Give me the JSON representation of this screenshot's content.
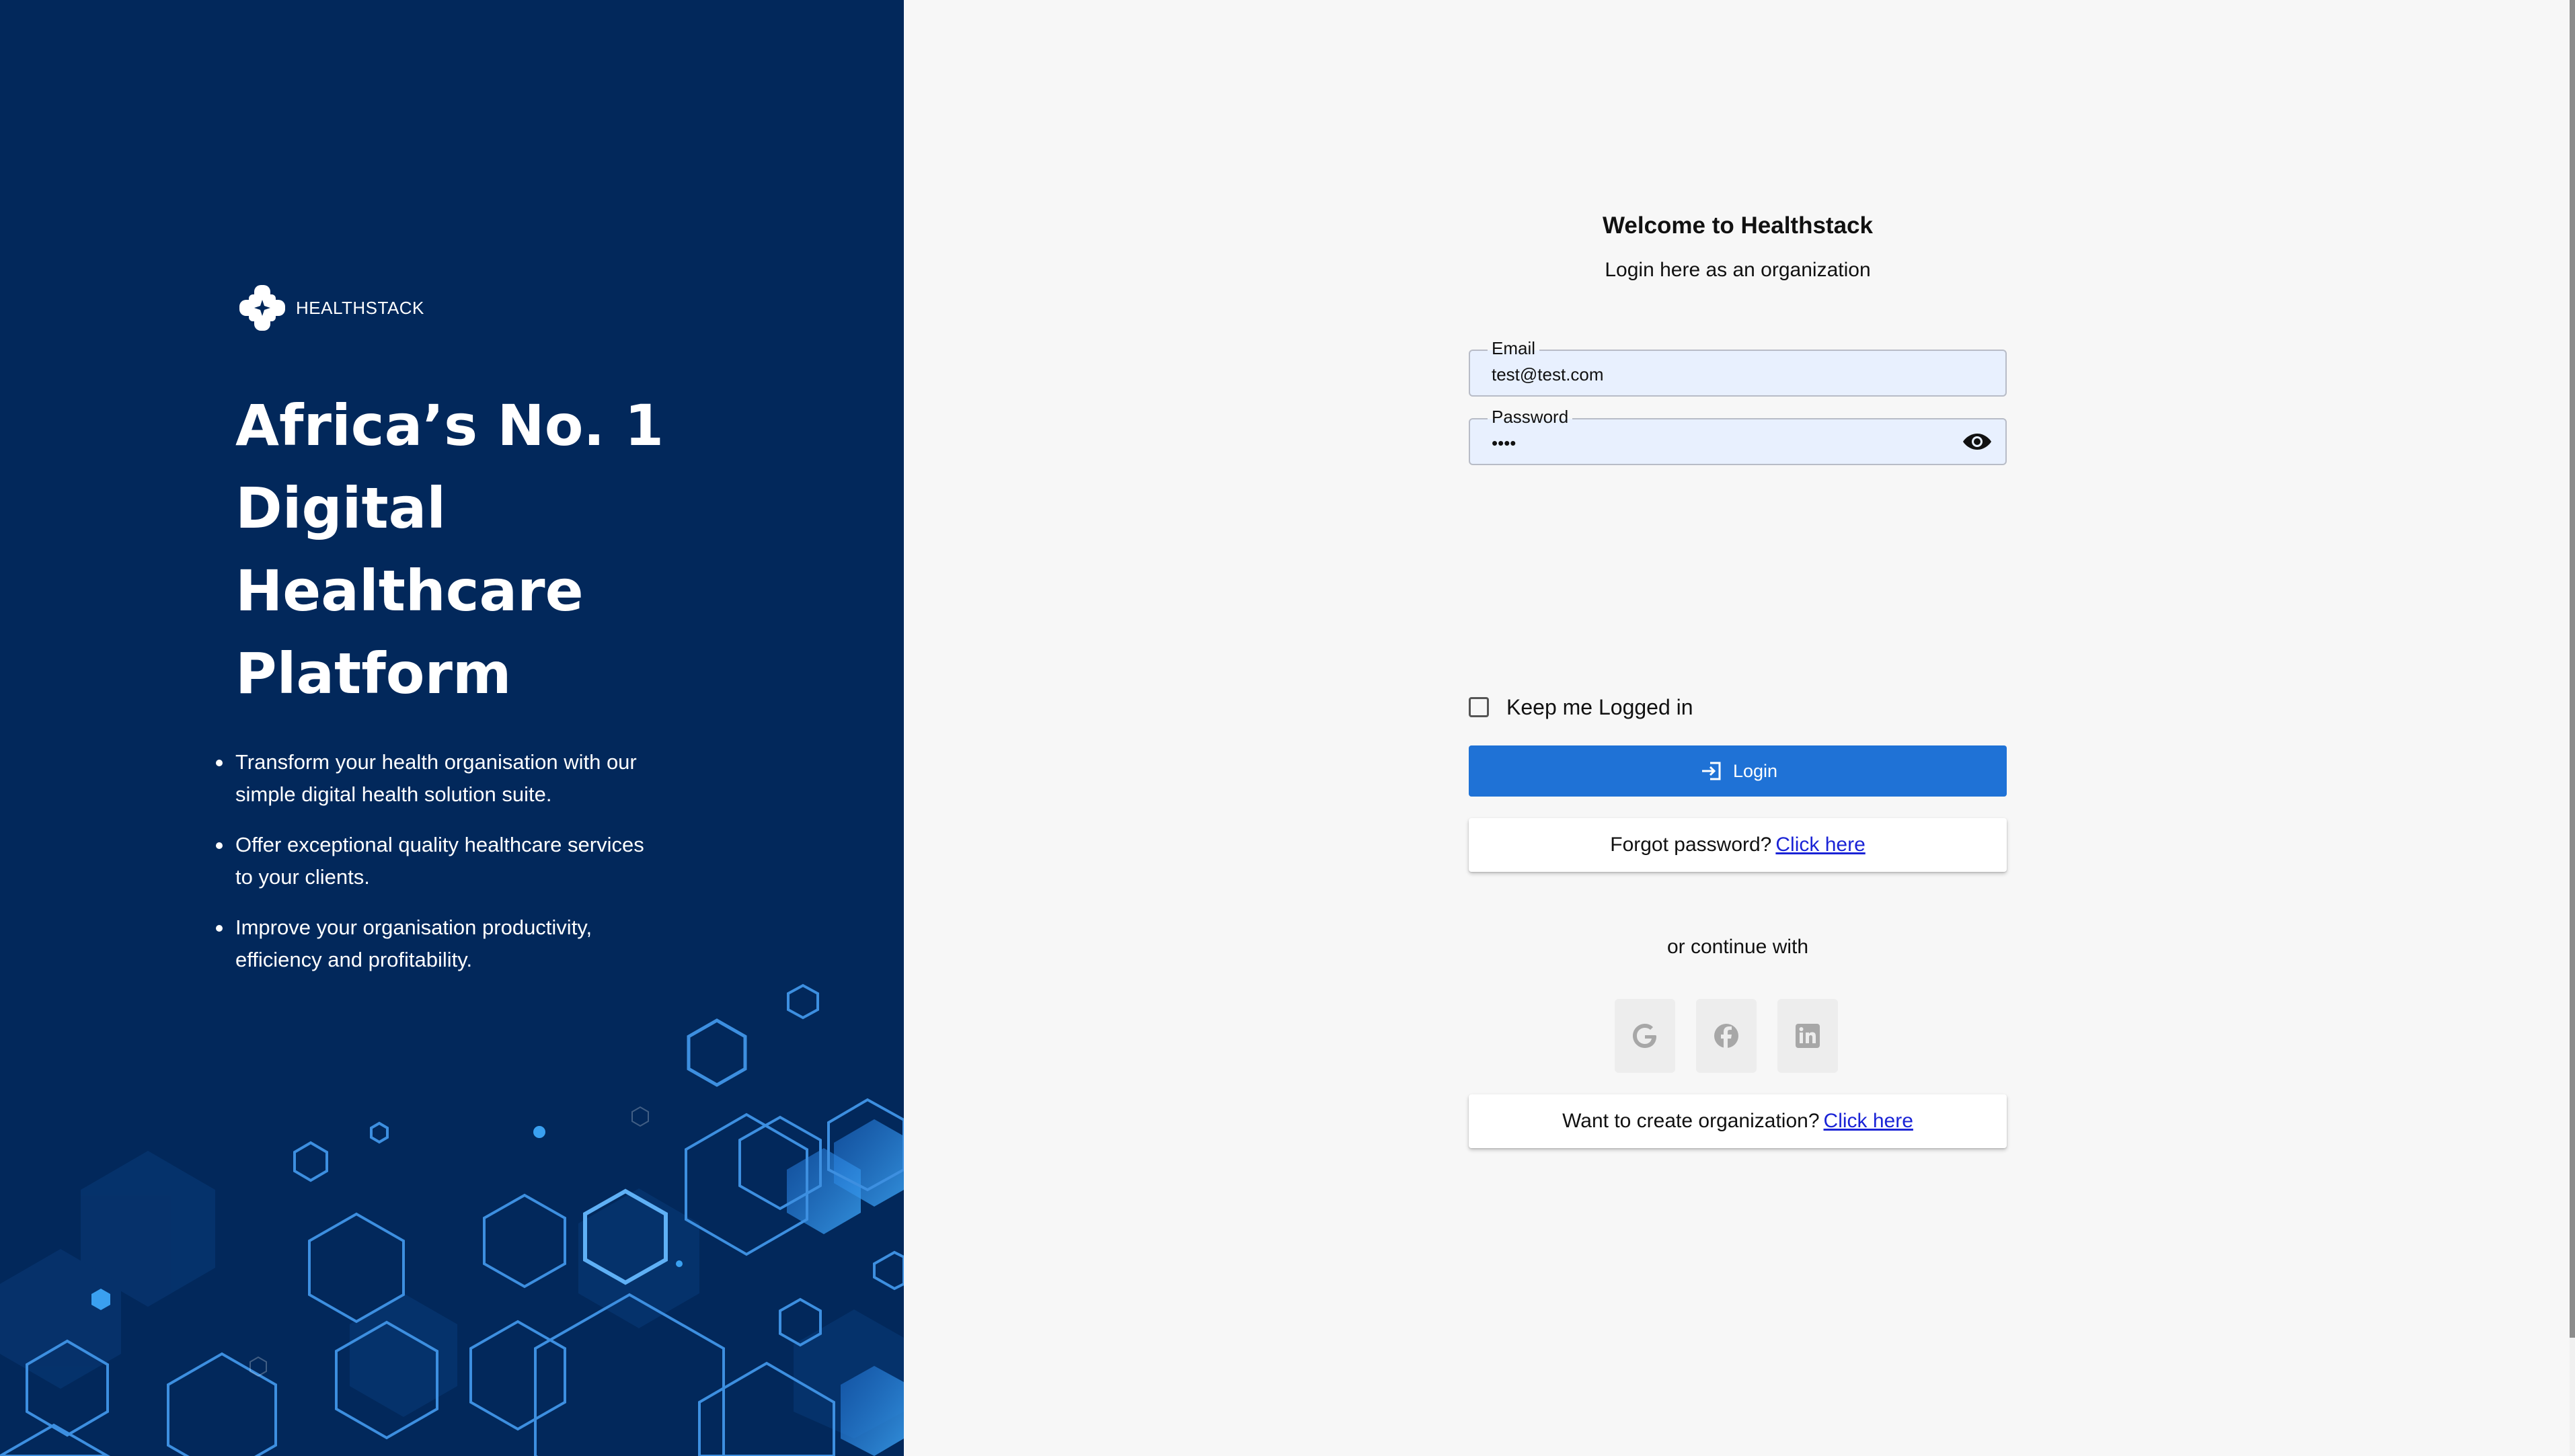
{
  "brand": {
    "name": "HEALTHSTACK"
  },
  "hero": {
    "headline_lines": [
      "Africa’s No. 1",
      "Digital",
      "Healthcare",
      "Platform"
    ],
    "bullets": [
      "Transform your health organisation with our simple digital health solution suite.",
      "Offer exceptional quality healthcare services to your clients.",
      "Improve your organisation productivity, efficiency and profitability."
    ]
  },
  "login": {
    "title": "Welcome to Healthstack",
    "subtitle": "Login here as an organization",
    "email_label": "Email",
    "email_value": "test@test.com",
    "password_label": "Password",
    "password_value": "••••",
    "keep_logged_in_label": "Keep me Logged in",
    "keep_logged_in_checked": false,
    "login_button_label": "Login",
    "forgot_text": "Forgot password?",
    "forgot_link": "Click here",
    "or_continue": "or continue with",
    "social": [
      "google-icon",
      "facebook-icon",
      "linkedin-icon"
    ],
    "create_text": "Want to create organization?",
    "create_link": "Click here"
  },
  "colors": {
    "panel_bg": "#02285b",
    "primary": "#1f72d6",
    "link": "#1a23d6",
    "input_bg": "#e8f0fe"
  }
}
